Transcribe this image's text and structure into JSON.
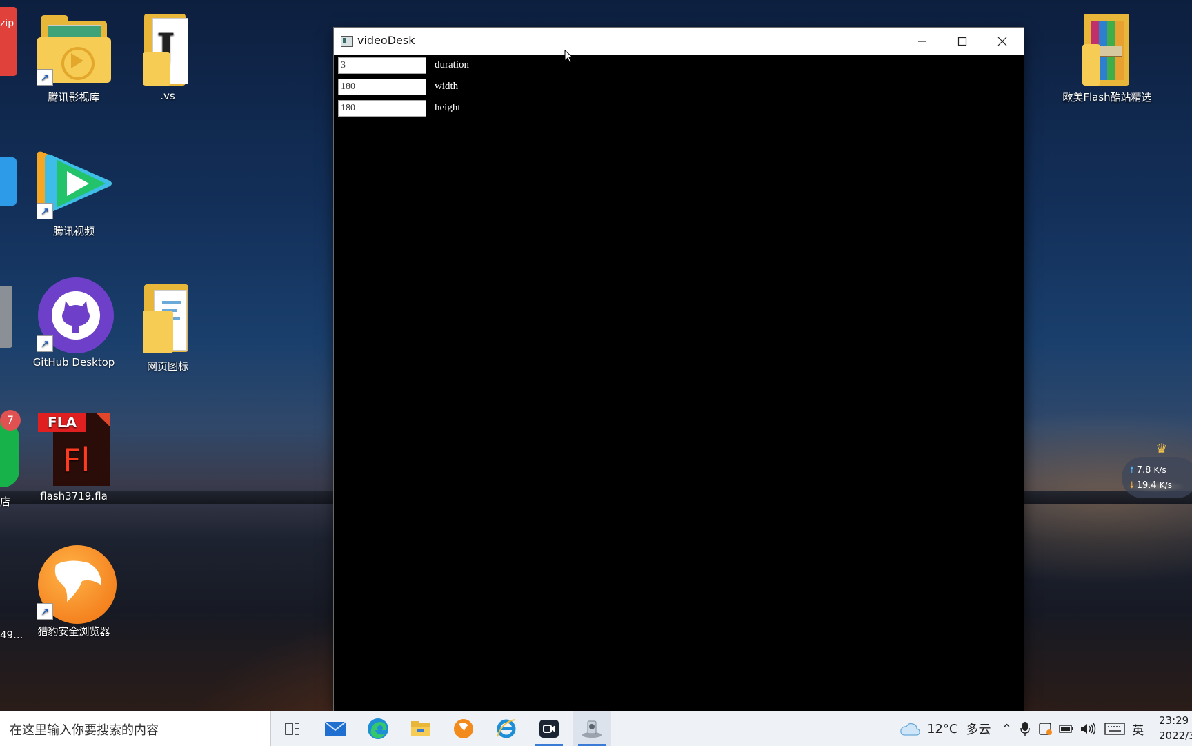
{
  "window": {
    "title": "videoDesk",
    "fields": [
      {
        "value": "3",
        "label": "duration"
      },
      {
        "value": "180",
        "label": "width"
      },
      {
        "value": "180",
        "label": "height"
      }
    ],
    "controls": {
      "minimize": "minimize-icon",
      "maximize": "maximize-icon",
      "close": "close-icon"
    }
  },
  "desktop": {
    "icons": [
      {
        "label": "腾讯影视库"
      },
      {
        "label": ".vs"
      },
      {
        "label": "腾讯视频"
      },
      {
        "label": "GitHub Desktop"
      },
      {
        "label": "网页图标"
      },
      {
        "label": "flash3719.fla"
      },
      {
        "label": "猎豹安全浏览器"
      },
      {
        "label": "欧美Flash酷站精选"
      }
    ],
    "partial_labels": [
      "zip",
      "店",
      "49...",
      "7",
      "FLA",
      "Fl"
    ]
  },
  "network_widget": {
    "upload": "7.8",
    "upload_unit": "K/s",
    "download": "19.4",
    "download_unit": "K/s"
  },
  "taskbar": {
    "search_placeholder": "在这里输入你要搜索的内容",
    "apps": [
      "task-view-icon",
      "mail-icon",
      "edge-icon",
      "file-explorer-icon",
      "browser-icon",
      "ie-icon",
      "video-record-icon",
      "videodesk-app-icon"
    ],
    "weather_temp": "12°C",
    "weather_desc": "多云",
    "ime": "英",
    "time": "23:29",
    "date": "2022/3"
  },
  "colors": {
    "taskbar_bg": "#eef1f6",
    "active_underline": "#3a7bd5",
    "window_bg": "#000000"
  }
}
